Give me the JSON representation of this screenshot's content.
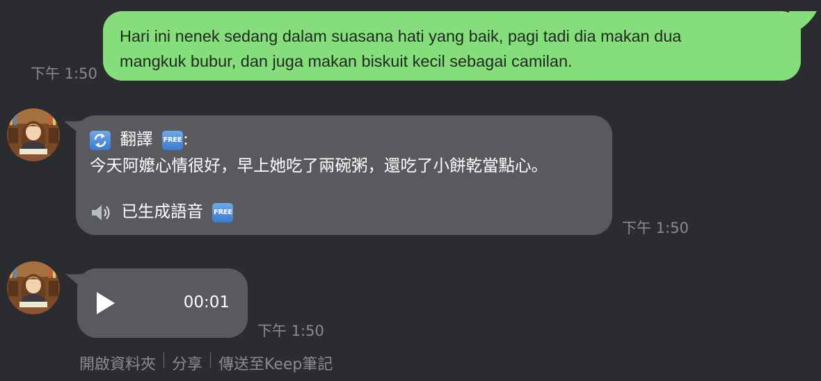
{
  "messages": {
    "outgoing": {
      "text_line1": "Hari ini nenek sedang dalam suasana hati yang baik, pagi tadi dia makan dua",
      "text_line2": "mangkuk bubur, dan juga makan biskuit kecil sebagai camilan.",
      "time": "下午 1:50"
    },
    "translation": {
      "header_label": "翻譯",
      "header_suffix": ":",
      "header_badge": "FREE",
      "text": "今天阿嬤心情很好，早上她吃了兩碗粥，還吃了小餅乾當點心。",
      "voice_label": "已生成語音",
      "voice_badge": "FREE",
      "time": "下午 1:50"
    },
    "audio": {
      "duration": "00:01",
      "time": "下午 1:50"
    }
  },
  "actions": {
    "open_folder": "開啟資料夾",
    "share": "分享",
    "send_to_keep": "傳送至Keep筆記"
  },
  "icons": {
    "translate": "refresh-arrows-icon",
    "speaker": "speaker-icon",
    "play": "play-icon",
    "free": "free-badge-icon"
  },
  "colors": {
    "background": "#2b2c30",
    "outgoing_bubble": "#85dd7b",
    "incoming_bubble": "#595a5e",
    "timestamp": "#8a8b8f"
  }
}
